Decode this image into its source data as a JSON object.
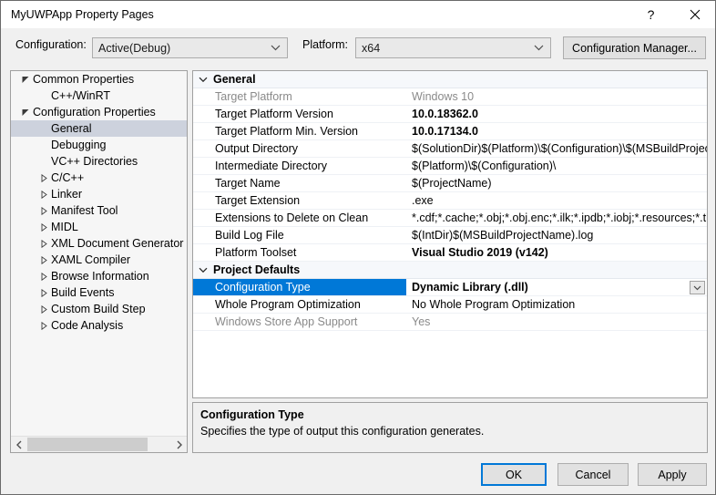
{
  "window": {
    "title": "MyUWPApp Property Pages",
    "help_icon": "?",
    "close_icon": "close-icon"
  },
  "toolbar": {
    "configuration_label": "Configuration:",
    "configuration_value": "Active(Debug)",
    "platform_label": "Platform:",
    "platform_value": "x64",
    "configuration_manager_label": "Configuration Manager..."
  },
  "tree": {
    "items": [
      {
        "label": "Common Properties",
        "indent": 0,
        "glyph": "expanded",
        "selected": false
      },
      {
        "label": "C++/WinRT",
        "indent": 1,
        "glyph": "none",
        "selected": false
      },
      {
        "label": "Configuration Properties",
        "indent": 0,
        "glyph": "expanded",
        "selected": false
      },
      {
        "label": "General",
        "indent": 1,
        "glyph": "none",
        "selected": true
      },
      {
        "label": "Debugging",
        "indent": 1,
        "glyph": "none",
        "selected": false
      },
      {
        "label": "VC++ Directories",
        "indent": 1,
        "glyph": "none",
        "selected": false
      },
      {
        "label": "C/C++",
        "indent": 1,
        "glyph": "collapsed",
        "selected": false
      },
      {
        "label": "Linker",
        "indent": 1,
        "glyph": "collapsed",
        "selected": false
      },
      {
        "label": "Manifest Tool",
        "indent": 1,
        "glyph": "collapsed",
        "selected": false
      },
      {
        "label": "MIDL",
        "indent": 1,
        "glyph": "collapsed",
        "selected": false
      },
      {
        "label": "XML Document Generator",
        "indent": 1,
        "glyph": "collapsed",
        "selected": false
      },
      {
        "label": "XAML Compiler",
        "indent": 1,
        "glyph": "collapsed",
        "selected": false
      },
      {
        "label": "Browse Information",
        "indent": 1,
        "glyph": "collapsed",
        "selected": false
      },
      {
        "label": "Build Events",
        "indent": 1,
        "glyph": "collapsed",
        "selected": false
      },
      {
        "label": "Custom Build Step",
        "indent": 1,
        "glyph": "collapsed",
        "selected": false
      },
      {
        "label": "Code Analysis",
        "indent": 1,
        "glyph": "collapsed",
        "selected": false
      }
    ],
    "hscrollbar": {
      "left_arrow": "‹",
      "right_arrow": "›"
    }
  },
  "grid": {
    "rows": [
      {
        "kind": "category",
        "label": "General",
        "expanded": true
      },
      {
        "kind": "property",
        "name": "Target Platform",
        "value": "Windows 10",
        "disabled": true,
        "bold": false,
        "selected": false,
        "dropdown": false
      },
      {
        "kind": "property",
        "name": "Target Platform Version",
        "value": "10.0.18362.0",
        "disabled": false,
        "bold": true,
        "selected": false,
        "dropdown": false
      },
      {
        "kind": "property",
        "name": "Target Platform Min. Version",
        "value": "10.0.17134.0",
        "disabled": false,
        "bold": true,
        "selected": false,
        "dropdown": false
      },
      {
        "kind": "property",
        "name": "Output Directory",
        "value": "$(SolutionDir)$(Platform)\\$(Configuration)\\$(MSBuildProjectName)\\",
        "disabled": false,
        "bold": false,
        "selected": false,
        "dropdown": false
      },
      {
        "kind": "property",
        "name": "Intermediate Directory",
        "value": "$(Platform)\\$(Configuration)\\",
        "disabled": false,
        "bold": false,
        "selected": false,
        "dropdown": false
      },
      {
        "kind": "property",
        "name": "Target Name",
        "value": "$(ProjectName)",
        "disabled": false,
        "bold": false,
        "selected": false,
        "dropdown": false
      },
      {
        "kind": "property",
        "name": "Target Extension",
        "value": ".exe",
        "disabled": false,
        "bold": false,
        "selected": false,
        "dropdown": false
      },
      {
        "kind": "property",
        "name": "Extensions to Delete on Clean",
        "value": "*.cdf;*.cache;*.obj;*.obj.enc;*.ilk;*.ipdb;*.iobj;*.resources;*.tlb;*.tli;*.tlh;*.tmp",
        "disabled": false,
        "bold": false,
        "selected": false,
        "dropdown": false
      },
      {
        "kind": "property",
        "name": "Build Log File",
        "value": "$(IntDir)$(MSBuildProjectName).log",
        "disabled": false,
        "bold": false,
        "selected": false,
        "dropdown": false
      },
      {
        "kind": "property",
        "name": "Platform Toolset",
        "value": "Visual Studio 2019 (v142)",
        "disabled": false,
        "bold": true,
        "selected": false,
        "dropdown": false
      },
      {
        "kind": "category",
        "label": "Project Defaults",
        "expanded": true
      },
      {
        "kind": "property",
        "name": "Configuration Type",
        "value": "Dynamic Library (.dll)",
        "disabled": false,
        "bold": true,
        "selected": true,
        "dropdown": true
      },
      {
        "kind": "property",
        "name": "Whole Program Optimization",
        "value": "No Whole Program Optimization",
        "disabled": false,
        "bold": false,
        "selected": false,
        "dropdown": false
      },
      {
        "kind": "property",
        "name": "Windows Store App Support",
        "value": "Yes",
        "disabled": true,
        "bold": false,
        "selected": false,
        "dropdown": false
      }
    ]
  },
  "description": {
    "title": "Configuration Type",
    "body": "Specifies the type of output this configuration generates."
  },
  "footer": {
    "ok_label": "OK",
    "cancel_label": "Cancel",
    "apply_label": "Apply"
  },
  "colors": {
    "selection_blue": "#0078d7",
    "tree_selection": "#cdd2dd",
    "dialog_bg": "#f0f0f0"
  }
}
